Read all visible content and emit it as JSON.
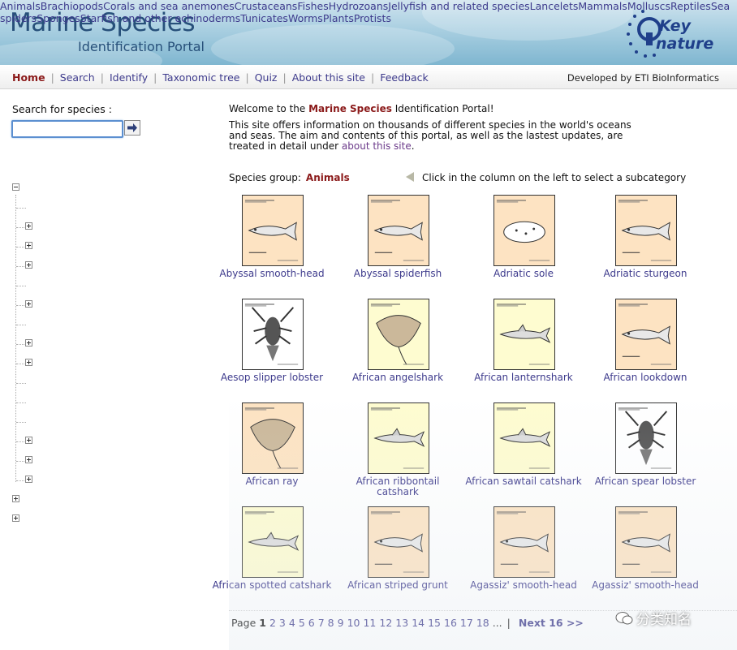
{
  "header": {
    "title": "Marine Species",
    "subtitle": "Identification Portal",
    "logo": {
      "text": "Keytonature"
    }
  },
  "nav": {
    "items": [
      {
        "label": "Home",
        "active": true
      },
      {
        "label": "Search"
      },
      {
        "label": "Identify"
      },
      {
        "label": "Taxonomic tree"
      },
      {
        "label": "Quiz"
      },
      {
        "label": "About this site"
      },
      {
        "label": "Feedback"
      }
    ],
    "developer": "Developed by ETI BioInformatics"
  },
  "search": {
    "label": "Search for species :",
    "value": "",
    "placeholder": "",
    "button_icon": "arrow-right-icon"
  },
  "tree": {
    "root": {
      "label": "Animals",
      "expanded": true
    },
    "children": [
      {
        "label": "Brachiopods",
        "expandable": false
      },
      {
        "label": "Corals and sea anemones",
        "expandable": true
      },
      {
        "label": "Crustaceans",
        "expandable": true
      },
      {
        "label": "Fishes",
        "expandable": true
      },
      {
        "label": "Hydrozoans",
        "expandable": false
      },
      {
        "label": "Jellyfish and related species",
        "expandable": true
      },
      {
        "label": "Lancelets",
        "expandable": false
      },
      {
        "label": "Mammals",
        "expandable": true
      },
      {
        "label": "Molluscs",
        "expandable": true
      },
      {
        "label": "Reptiles",
        "expandable": false
      },
      {
        "label": "Sea spiders",
        "expandable": false
      },
      {
        "label": "Sponges",
        "expandable": false
      },
      {
        "label": "Starfish and other echinoderms",
        "expandable": true
      },
      {
        "label": "Tunicates",
        "expandable": true
      },
      {
        "label": "Worms",
        "expandable": true
      }
    ],
    "others": [
      {
        "label": "Plants",
        "expandable": true
      },
      {
        "label": "Protists",
        "expandable": true
      }
    ]
  },
  "main": {
    "welcome_pre": "Welcome to the",
    "welcome_brand": "Marine Species",
    "welcome_post": "Identification Portal!",
    "intro_text": "This site offers information on thousands of different species in the world's oceans and seas. The aim and contents of this portal, as well as the lastest updates, are treated in detail under",
    "intro_link": "about this site",
    "intro_end": ".",
    "group_label": "Species group:",
    "group_value": "Animals",
    "hint": "Click in the column on the left to select a subcategory"
  },
  "species": [
    {
      "name": "Abyssal smooth-head",
      "bg": "#fde3c2",
      "icon": "fish-icon"
    },
    {
      "name": "Abyssal spiderfish",
      "bg": "#fde3c2",
      "icon": "fish-icon"
    },
    {
      "name": "Adriatic sole",
      "bg": "#fde3c2",
      "icon": "flatfish-icon"
    },
    {
      "name": "Adriatic sturgeon",
      "bg": "#fde3c2",
      "icon": "fish-icon"
    },
    {
      "name": "Aesop slipper lobster",
      "bg": "#ffffff",
      "icon": "lobster-icon"
    },
    {
      "name": "African angelshark",
      "bg": "#fefcd0",
      "icon": "ray-icon"
    },
    {
      "name": "African lanternshark",
      "bg": "#fefcd0",
      "icon": "shark-icon"
    },
    {
      "name": "African lookdown",
      "bg": "#fde3c2",
      "icon": "fish-icon"
    },
    {
      "name": "African ray",
      "bg": "#fde3c2",
      "icon": "ray-icon"
    },
    {
      "name": "African ribbontail catshark",
      "bg": "#fefcd0",
      "icon": "shark-icon"
    },
    {
      "name": "African sawtail catshark",
      "bg": "#fefcd0",
      "icon": "shark-icon"
    },
    {
      "name": "African spear lobster",
      "bg": "#ffffff",
      "icon": "lobster-icon"
    },
    {
      "name": "African spotted catshark",
      "bg": "#fefcd0",
      "icon": "shark-icon"
    },
    {
      "name": "African striped grunt",
      "bg": "#fde3c2",
      "icon": "fish-icon"
    },
    {
      "name": "Agassiz' smooth-head",
      "bg": "#fde3c2",
      "icon": "fish-icon"
    },
    {
      "name": "Agassiz' smooth-head",
      "bg": "#fde3c2",
      "icon": "fish-icon"
    }
  ],
  "pager": {
    "label": "Page",
    "current": "1",
    "pages": [
      "2",
      "3",
      "4",
      "5",
      "6",
      "7",
      "8",
      "9",
      "10",
      "11",
      "12",
      "13",
      "14",
      "15",
      "16",
      "17",
      "18"
    ],
    "ellipsis": "...",
    "separator": "|",
    "next": "Next 16 >>"
  },
  "watermark": "分类知名",
  "colors": {
    "accent": "#8b1a1a",
    "link": "#3d3a8c"
  }
}
